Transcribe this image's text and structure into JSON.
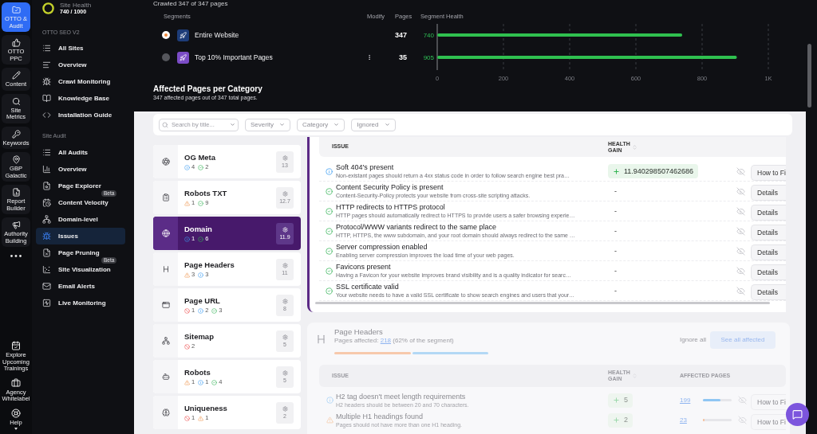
{
  "rail": {
    "items": [
      {
        "label": "OTTO & Audit",
        "selected": true
      },
      {
        "label": "OTTO PPC",
        "selected": false
      },
      {
        "label": "Content",
        "selected": false
      },
      {
        "label": "Site Metrics",
        "selected": false
      },
      {
        "label": "Keywords",
        "selected": false
      },
      {
        "label": "GBP Galactic",
        "selected": false
      },
      {
        "label": "Report Builder",
        "selected": false
      },
      {
        "label": "Authority Building",
        "selected": false
      }
    ],
    "bottom_items": [
      {
        "label": "Explore Upcoming Trainings"
      },
      {
        "label": "Agency Whitelabel"
      },
      {
        "label": "Help"
      }
    ]
  },
  "sidebar": {
    "health": {
      "label": "Site Health",
      "value": "740 / 1000"
    },
    "sections": [
      {
        "title": "OTTO SEO V2",
        "items": [
          {
            "label": "All Sites",
            "selected": false
          },
          {
            "label": "Overview",
            "selected": false
          },
          {
            "label": "Crawl Monitoring",
            "selected": false
          },
          {
            "label": "Knowledge Base",
            "selected": false
          },
          {
            "label": "Installation Guide",
            "selected": false
          }
        ]
      },
      {
        "title": "Site Audit",
        "items": [
          {
            "label": "All Audits",
            "selected": false
          },
          {
            "label": "Overview",
            "selected": false
          },
          {
            "label": "Page Explorer",
            "selected": false
          },
          {
            "label": "Content Velocity",
            "badge": "Beta",
            "selected": false
          },
          {
            "label": "Domain-level",
            "selected": false
          },
          {
            "label": "Issues",
            "selected": true
          },
          {
            "label": "Page Pruning",
            "selected": false
          },
          {
            "label": "Site Visualization",
            "badge": "Beta",
            "selected": false
          },
          {
            "label": "Email Alerts",
            "selected": false
          },
          {
            "label": "Live Monitoring",
            "selected": false
          }
        ]
      }
    ]
  },
  "crawl_status": "Crawled 347 of 347 pages",
  "segments": {
    "columns": [
      "Segments",
      "Modify",
      "Pages",
      "Segment Health"
    ],
    "rows": [
      {
        "name": "Entire Website",
        "pages": "347",
        "selected": true,
        "color": "#1d3c78",
        "has_menu": false
      },
      {
        "name": "Top 10% Important Pages",
        "pages": "35",
        "selected": false,
        "color": "#7b4cc6",
        "has_menu": true
      }
    ],
    "chart_data": {
      "type": "bar",
      "orientation": "horizontal",
      "values": [
        740,
        905
      ],
      "xlim": [
        0,
        1000
      ],
      "xticks": [
        0,
        200,
        400,
        600,
        800,
        {
          "value": 1000,
          "label": "1K"
        }
      ],
      "grid": true,
      "data_labels": true
    }
  },
  "affected_summary": {
    "title": "Affected Pages per Category",
    "subtitle": "347 affected pages out of 347 total pages."
  },
  "filters": {
    "search": {
      "placeholder": "Search by title..."
    },
    "dropdowns": [
      {
        "label": "Severity"
      },
      {
        "label": "Category"
      },
      {
        "label": "Ignored"
      }
    ]
  },
  "categories": [
    {
      "name": "OG Meta",
      "selected": false,
      "score": "13",
      "counts": [
        {
          "kind": "info",
          "value": "4"
        },
        {
          "kind": "ok",
          "value": "2"
        }
      ]
    },
    {
      "name": "Robots TXT",
      "selected": false,
      "score": "12.7",
      "counts": [
        {
          "kind": "warning",
          "value": "1"
        },
        {
          "kind": "ok",
          "value": "9"
        }
      ]
    },
    {
      "name": "Domain",
      "selected": true,
      "score": "11.9",
      "counts": [
        {
          "kind": "info",
          "value": "1"
        },
        {
          "kind": "ok",
          "value": "6"
        }
      ]
    },
    {
      "name": "Page Headers",
      "selected": false,
      "score": "11",
      "counts": [
        {
          "kind": "warning",
          "value": "3"
        },
        {
          "kind": "info",
          "value": "3"
        }
      ]
    },
    {
      "name": "Page URL",
      "selected": false,
      "score": "8",
      "counts": [
        {
          "kind": "error",
          "value": "1"
        },
        {
          "kind": "info",
          "value": "2"
        },
        {
          "kind": "ok",
          "value": "3"
        }
      ]
    },
    {
      "name": "Sitemap",
      "selected": false,
      "score": "5",
      "counts": [
        {
          "kind": "error",
          "value": "2"
        }
      ]
    },
    {
      "name": "Robots",
      "selected": false,
      "score": "5",
      "counts": [
        {
          "kind": "warning",
          "value": "1"
        },
        {
          "kind": "info",
          "value": "1"
        },
        {
          "kind": "ok",
          "value": "4"
        }
      ]
    },
    {
      "name": "Uniqueness",
      "selected": false,
      "score": "2",
      "counts": [
        {
          "kind": "error",
          "value": "1"
        },
        {
          "kind": "warning",
          "value": "1"
        }
      ]
    }
  ],
  "domain_issues": {
    "columns": [
      "ISSUE",
      "HEALTH GAIN"
    ],
    "rows": [
      {
        "kind": "info",
        "title": "Soft 404's present",
        "description": "Non-existant pages should return a 4xx status code in order to follow search engine best pra…",
        "gain": {
          "kind": "badge",
          "text": "11.940298507462686"
        },
        "action": "How to Fi"
      },
      {
        "kind": "ok",
        "title": "Content Security Policy is present",
        "description": "Content-Security-Policy protects your website from cross-site scripting attacks.",
        "gain": {
          "kind": "dash",
          "text": "-"
        },
        "action": "Details"
      },
      {
        "kind": "ok",
        "title": "HTTP redirects to HTTPS protocol",
        "description": "HTTP pages should automatically redirect to HTTPS to provide users a safer browsing experie…",
        "gain": {
          "kind": "dash",
          "text": "-"
        },
        "action": "Details"
      },
      {
        "kind": "ok",
        "title": "Protocol/WWW variants redirect to the same place",
        "description": "HTTP, HTTPS, the www subdomain, and your root domain should always redirect to the same …",
        "gain": {
          "kind": "dash",
          "text": "-"
        },
        "action": "Details"
      },
      {
        "kind": "ok",
        "title": "Server compression enabled",
        "description": "Enabling server compression improves the load time of your web pages.",
        "gain": {
          "kind": "dash",
          "text": "-"
        },
        "action": "Details"
      },
      {
        "kind": "ok",
        "title": "Favicons present",
        "description": "Having a Favicon for your website improves brand visibility and is a quality indicator for searc…",
        "gain": {
          "kind": "dash",
          "text": "-"
        },
        "action": "Details"
      },
      {
        "kind": "ok",
        "title": "SSL certificate valid",
        "description": "Your website needs to have a valid SSL certificate to show search engines and users that your…",
        "gain": {
          "kind": "dash",
          "text": "-"
        },
        "action": "Details"
      }
    ]
  },
  "page_headers": {
    "title": "Page Headers",
    "affected_label": "Pages affected:",
    "affected_count": "218",
    "affected_note": "(62% of the segment)",
    "severity_bar": [
      {
        "color": "#f7c9ac"
      },
      {
        "color": "#b3d8f5"
      }
    ],
    "ignore_all": "Ignore all",
    "see_all": "See all affected",
    "columns": [
      "ISSUE",
      "HEALTH GAIN",
      "AFFECTED PAGES"
    ],
    "rows": [
      {
        "kind": "info",
        "title": "H2 tag doesn't meet length requirements",
        "description": "H2 headers should be between 20 and 70 characters.",
        "gain": {
          "kind": "badge",
          "text": "5"
        },
        "affected": "199",
        "level": 0.6,
        "action": "How to Fi"
      },
      {
        "kind": "warning",
        "title": "Multiple H1 headings found",
        "description": "Pages should not have more than one H1 heading.",
        "gain": {
          "kind": "badge",
          "text": "2"
        },
        "affected": "23",
        "level": 0.06,
        "action": "How to Fi"
      }
    ]
  }
}
